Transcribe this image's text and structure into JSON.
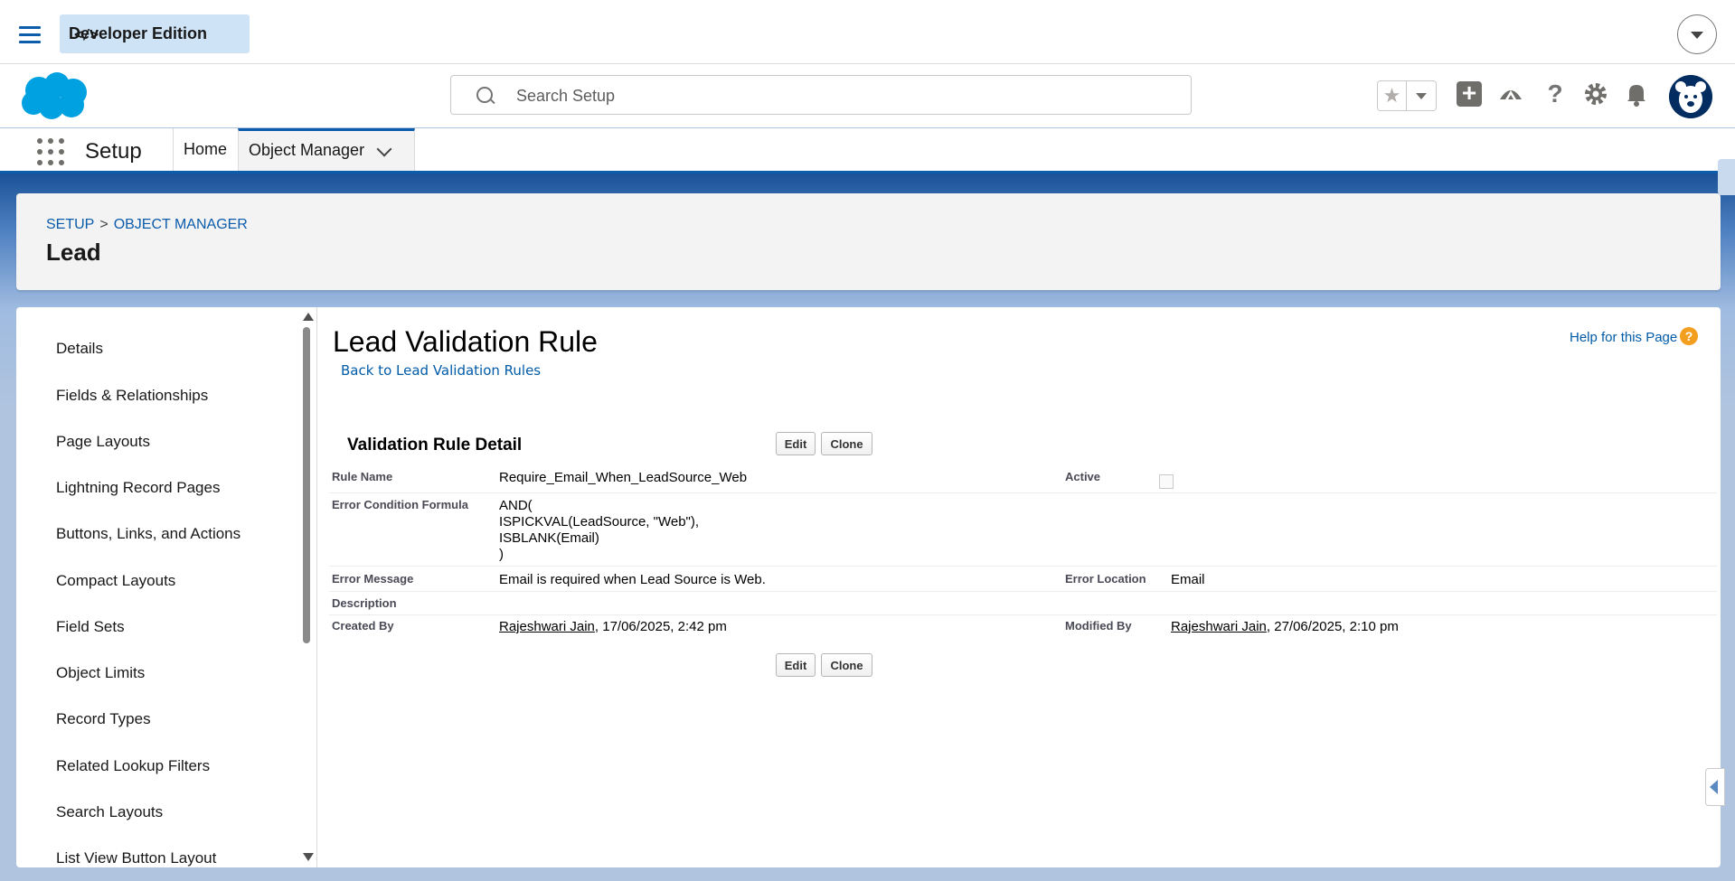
{
  "devbar": {
    "code_glyph": "</>",
    "label": "Developer Edition"
  },
  "header": {
    "search_placeholder": "Search Setup"
  },
  "nav": {
    "app_title": "Setup",
    "tab_home": "Home",
    "tab_object_manager": "Object Manager"
  },
  "page_header": {
    "crumb_setup": "SETUP",
    "crumb_sep": ">",
    "crumb_object_manager": "OBJECT MANAGER",
    "title": "Lead"
  },
  "sidebar": {
    "items": [
      "Details",
      "Fields & Relationships",
      "Page Layouts",
      "Lightning Record Pages",
      "Buttons, Links, and Actions",
      "Compact Layouts",
      "Field Sets",
      "Object Limits",
      "Record Types",
      "Related Lookup Filters",
      "Search Layouts",
      "List View Button Layout"
    ]
  },
  "content": {
    "title": "Lead Validation Rule",
    "back_link": "Back to Lead Validation Rules",
    "help_link": "Help for this Page",
    "help_icon": "?",
    "detail_title": "Validation Rule Detail",
    "edit_label": "Edit",
    "clone_label": "Clone",
    "labels": {
      "rule_name": "Rule Name",
      "active": "Active",
      "error_condition_formula": "Error Condition Formula",
      "error_message": "Error Message",
      "error_location": "Error Location",
      "description": "Description",
      "created_by": "Created By",
      "modified_by": "Modified By"
    },
    "values": {
      "rule_name": "Require_Email_When_LeadSource_Web",
      "active": false,
      "formula_lines": [
        "AND(",
        "ISPICKVAL(LeadSource, \"Web\"),",
        "ISBLANK(Email)",
        ")"
      ],
      "error_message": "Email is required when Lead Source is Web.",
      "error_location": "Email",
      "description": "",
      "created_by_user": "Rajeshwari Jain",
      "created_by_date": ", 17/06/2025, 2:42 pm",
      "modified_by_user": "Rajeshwari Jain",
      "modified_by_date": ", 27/06/2025, 2:10 pm"
    }
  },
  "colors": {
    "brand_blue": "#0b5cab",
    "link_blue": "#015ba7",
    "help_orange": "#f29e1e",
    "salesforce_cloud": "#00a1e0"
  }
}
